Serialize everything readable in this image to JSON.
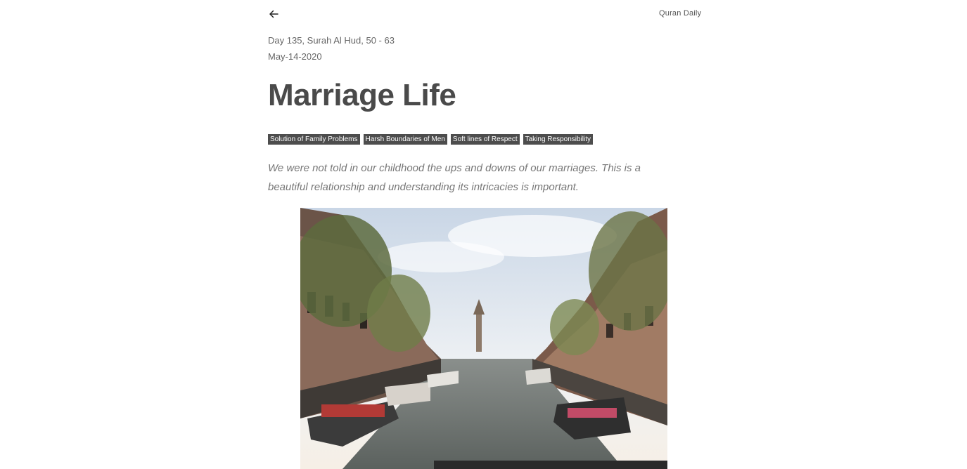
{
  "header": {
    "back_icon": "arrow-left-icon",
    "brand": "Quran Daily"
  },
  "post": {
    "day_line": "Day 135, Surah Al Hud, 50 - 63",
    "date": "May-14-2020",
    "title": "Marriage Life",
    "tags": [
      "Solution of Family Problems",
      "Harsh Boundaries of Men",
      "Soft lines of Respect",
      "Taking Responsibility"
    ],
    "excerpt": "We were not told in our childhood the ups and downs of our marriages. This is a beautiful relationship and understanding its intricacies is important."
  },
  "colors": {
    "tag_bg": "#4d4d4d",
    "title": "#4a4a4a",
    "text_muted": "#777777"
  }
}
